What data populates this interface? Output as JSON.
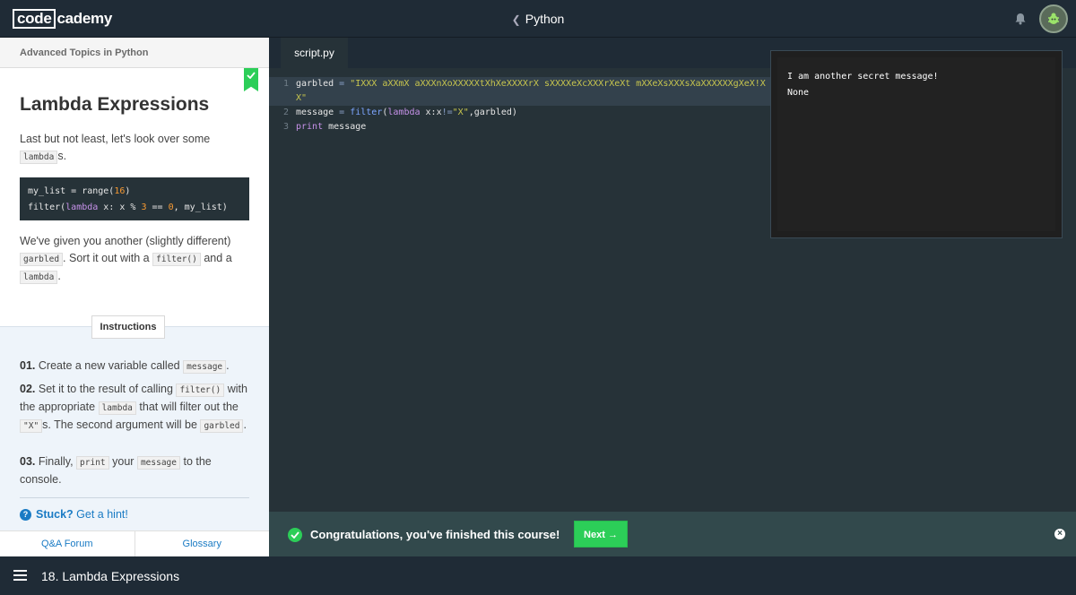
{
  "brand": {
    "logo_box": "code",
    "logo_rest": "cademy"
  },
  "topbar": {
    "course": "Python",
    "chevron_icon": "chevron-left-icon",
    "bell_icon": "bell-icon",
    "avatar_icon": "bug-avatar-icon"
  },
  "lesson": {
    "section": "Advanced Topics in Python",
    "title": "Lambda Expressions",
    "intro_prefix": "Last but not least, let's look over some",
    "intro_code": "lambda",
    "intro_suffix": "s.",
    "code_block": {
      "line1": {
        "a": "my_list = range(",
        "num": "16",
        "b": ")"
      },
      "line2": {
        "a": "filter(",
        "kw": "lambda",
        "b": " x: x % ",
        "n1": "3",
        "c": " == ",
        "n2": "0",
        "d": ", my_list)"
      }
    },
    "given_prefix": "We've given you another (slightly different)",
    "given_code1": "garbled",
    "given_mid": ". Sort it out with a",
    "given_code2": "filter()",
    "given_and": "and a",
    "given_code3": "lambda",
    "given_end": "."
  },
  "instructions": {
    "tab_label": "Instructions",
    "step1": {
      "num": "01.",
      "text": "Create a new variable called",
      "code": "message",
      "end": "."
    },
    "step2": {
      "num": "02.",
      "text1": "Set it to the result of calling",
      "code1": "filter()",
      "text2": "with the appropriate",
      "code2": "lambda",
      "text3": "that will filter out the",
      "code3": "\"X\"",
      "text4": "s. The second argument will be",
      "code4": "garbled",
      "end": "."
    },
    "step3": {
      "num": "03.",
      "text1": "Finally,",
      "code1": "print",
      "text2": "your",
      "code2": "message",
      "text3": "to the console."
    },
    "hint_label": "Stuck?",
    "hint_link": "Get a hint!"
  },
  "left_footer": {
    "qa": "Q&A Forum",
    "glossary": "Glossary"
  },
  "editor": {
    "tab_label": "script.py",
    "lines": [
      {
        "num": "1",
        "var": "garbled ",
        "eq": "=",
        "str": " \"IXXX aXXmX aXXXnXoXXXXXtXhXeXXXXrX sXXXXeXcXXXrXeXt mXXeXsXXXsXaXXXXXXgXeX!XX\""
      },
      {
        "num": "2",
        "a": "message ",
        "eq": "=",
        "fn": " filter",
        "b": "(",
        "kw": "lambda",
        "c": " x:x",
        "op": "!=",
        "str": "\"X\"",
        "d": ",garbled)"
      },
      {
        "num": "3",
        "kw": "print",
        "a": " message"
      }
    ]
  },
  "console": {
    "output": "I am another secret message!\nNone"
  },
  "success": {
    "text": "Congratulations, you've finished this course!",
    "next": "Next →",
    "close": "×"
  },
  "bottom": {
    "title": "18. Lambda Expressions"
  },
  "colors": {
    "accent_green": "#2cce58",
    "link_blue": "#1a7bc4",
    "editor_bg": "#263238"
  }
}
